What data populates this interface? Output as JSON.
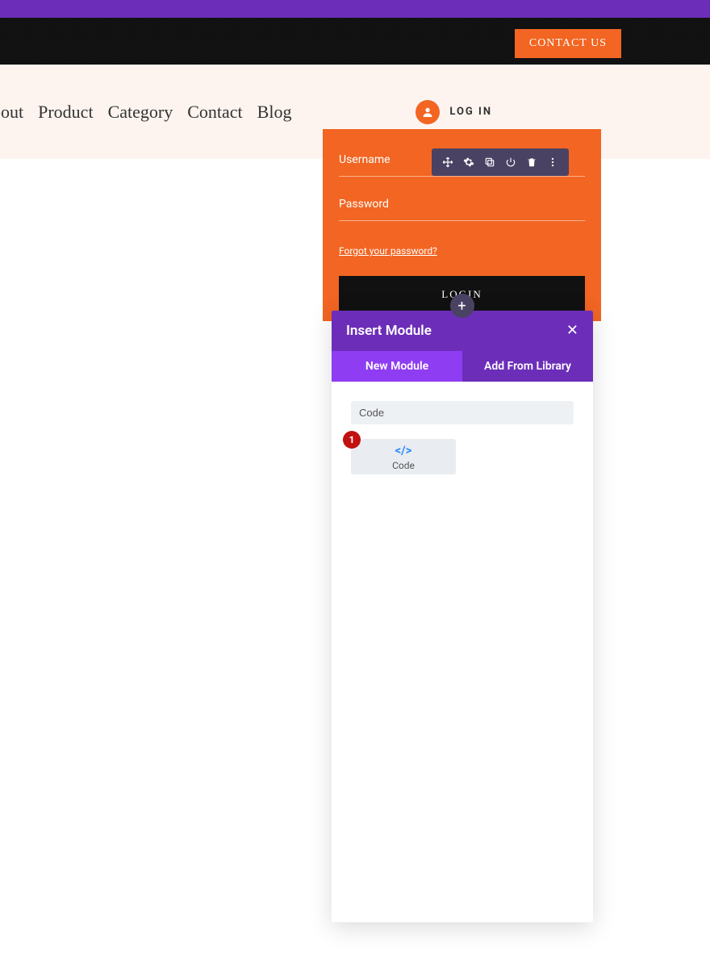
{
  "topbar": {
    "contact_label": "CONTACT US"
  },
  "nav": {
    "items": [
      "bout",
      "Product",
      "Category",
      "Contact",
      "Blog"
    ],
    "login_label": "LOG IN"
  },
  "login_form": {
    "username_label": "Username",
    "password_label": "Password",
    "forgot_label": "Forgot your password?",
    "login_btn": "LOGIN"
  },
  "toolbar": {
    "icons": [
      "move",
      "gear",
      "duplicate",
      "power",
      "trash",
      "more"
    ]
  },
  "plus": "+",
  "modal": {
    "title": "Insert Module",
    "close": "✕",
    "tab_new": "New Module",
    "tab_library": "Add From Library",
    "search_value": "Code",
    "module_name": "Code",
    "badge": "1"
  }
}
